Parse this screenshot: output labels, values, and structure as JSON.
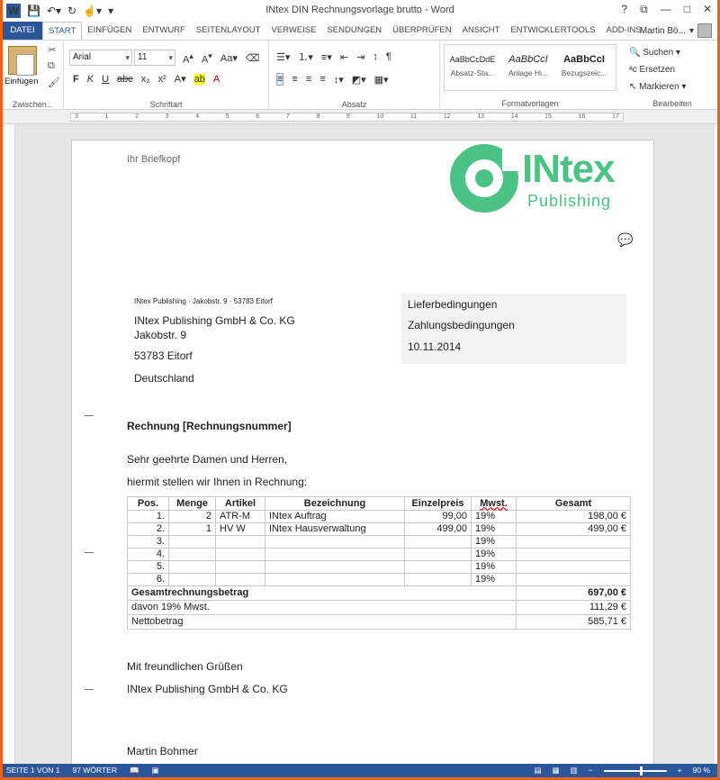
{
  "window": {
    "title": "INtex DIN Rechnungsvorlage brutto - Word",
    "qat_icons": [
      "word-icon",
      "save-icon",
      "undo-icon",
      "redo-icon",
      "touch-icon",
      "customize-icon"
    ],
    "controls": {
      "help": "?",
      "restore": "⧉",
      "minimize": "—",
      "maximize": "□",
      "close": "✕"
    }
  },
  "tabs": [
    "DATEI",
    "START",
    "EINFÜGEN",
    "ENTWURF",
    "SEITENLAYOUT",
    "VERWEISE",
    "SENDUNGEN",
    "ÜBERPRÜFEN",
    "ANSICHT",
    "ENTWICKLERTOOLS",
    "ADD-INS"
  ],
  "user": "Martin Bö...",
  "ribbon": {
    "paste_label": "Einfügen",
    "clipboard_label": "Zwischen...",
    "font_name": "Arial",
    "font_size": "11",
    "font_label": "Schriftart",
    "paragraph_label": "Absatz",
    "styles": [
      {
        "preview": "AaBbCcDdE",
        "name": "Absatz-Sta..."
      },
      {
        "preview": "AaBbCcI",
        "name": "Anlage Hi..."
      },
      {
        "preview": "AaBbCcI",
        "name": "Bezugszeic..."
      }
    ],
    "styles_label": "Formatvorlagen",
    "edit": {
      "find": "Suchen",
      "replace": "Ersetzen",
      "select": "Markieren"
    },
    "edit_label": "Bearbeiten"
  },
  "document": {
    "letterhead": "Ihr Briefkopf",
    "logo": {
      "brand": "INtex",
      "sub": "Publishing"
    },
    "sender_line": "INtex Publishing · Jakobstr. 9 · 53783 Eitorf",
    "recipient": [
      "INtex Publishing GmbH & Co. KG",
      "Jakobstr. 9",
      "53783 Eitorf",
      "Deutschland"
    ],
    "info": [
      "Lieferbedingungen",
      "Zahlungsbedingungen",
      "10.11.2014"
    ],
    "subject": "Rechnung [Rechnungsnummer]",
    "greeting": "Sehr geehrte Damen und Herren,",
    "intro": "hiermit stellen wir Ihnen in Rechnung:",
    "table": {
      "headers": [
        "Pos.",
        "Menge",
        "Artikel",
        "Bezeichnung",
        "Einzelpreis",
        "Mwst.",
        "Gesamt"
      ],
      "rows": [
        [
          "1.",
          "2",
          "ATR-M",
          "INtex Auftrag",
          "99,00",
          "19%",
          "198,00 €"
        ],
        [
          "2.",
          "1",
          "HV W",
          "INtex Hausverwaltung",
          "499,00",
          "19%",
          "499,00 €"
        ],
        [
          "3.",
          "",
          "",
          "",
          "",
          "19%",
          ""
        ],
        [
          "4.",
          "",
          "",
          "",
          "",
          "19%",
          ""
        ],
        [
          "5.",
          "",
          "",
          "",
          "",
          "19%",
          ""
        ],
        [
          "6.",
          "",
          "",
          "",
          "",
          "19%",
          ""
        ]
      ],
      "total_label": "Gesamtrechnungsbetrag",
      "total_value": "697,00 €",
      "vat_label": "davon 19% Mwst.",
      "vat_value": "111,29 €",
      "net_label": "Nettobetrag",
      "net_value": "585,71 €"
    },
    "closing": "Mit freundlichen Grüßen",
    "company": "INtex Publishing GmbH & Co. KG",
    "signer": "Martin Bohmer"
  },
  "statusbar": {
    "page": "SEITE 1 VON 1",
    "words": "97 WÖRTER",
    "zoom": "90 %"
  },
  "colors": {
    "accent": "#2b579a",
    "logo_green": "#4bc384",
    "frame": "#e8631c"
  }
}
